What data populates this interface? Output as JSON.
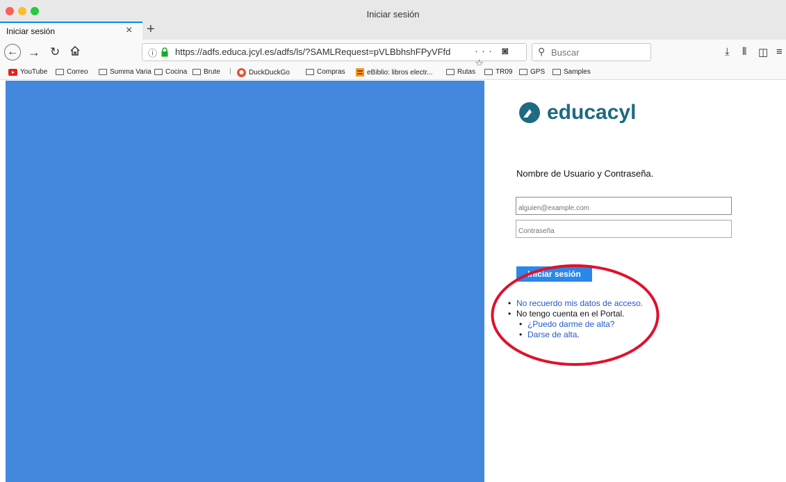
{
  "window": {
    "title": "Iniciar sesión"
  },
  "tabs": [
    {
      "label": "Iniciar sesión"
    }
  ],
  "navbar": {
    "url": "https://adfs.educa.jcyl.es/adfs/ls/?SAMLRequest=pVLBbhshFPyVFfd",
    "search_placeholder": "Buscar"
  },
  "bookmarks": [
    {
      "label": "YouTube",
      "icon": "youtube-icon"
    },
    {
      "label": "Correo",
      "icon": "folder-icon"
    },
    {
      "label": "Summa Varia",
      "icon": "folder-icon"
    },
    {
      "label": "Cocina",
      "icon": "folder-icon"
    },
    {
      "label": "Brute",
      "icon": "folder-icon"
    },
    {
      "label": "DuckDuckGo",
      "icon": "duckduckgo-icon"
    },
    {
      "label": "Compras",
      "icon": "folder-icon"
    },
    {
      "label": "eBiblio: libros electr...",
      "icon": "ebiblio-icon"
    },
    {
      "label": "Rutas",
      "icon": "folder-icon"
    },
    {
      "label": "TR09",
      "icon": "folder-icon"
    },
    {
      "label": "GPS",
      "icon": "folder-icon"
    },
    {
      "label": "Samples",
      "icon": "folder-icon"
    }
  ],
  "login": {
    "logo_text": "educacyl",
    "heading": "Nombre de Usuario y Contraseña.",
    "email_placeholder": "alguien@example.com",
    "password_placeholder": "Contraseña",
    "submit_label": "Iniciar sesión",
    "links": {
      "forgot": "No recuerdo mis datos de acceso.",
      "no_account": "No tengo cuenta en el Portal.",
      "can_register": "¿Puedo darme de alta?",
      "register": "Darse de alta",
      "register_suffix": "."
    }
  },
  "colors": {
    "left_panel": "#4488dd",
    "accent": "#2a88e8",
    "annotation": "#e0112b",
    "logo": "#1d6a83"
  }
}
